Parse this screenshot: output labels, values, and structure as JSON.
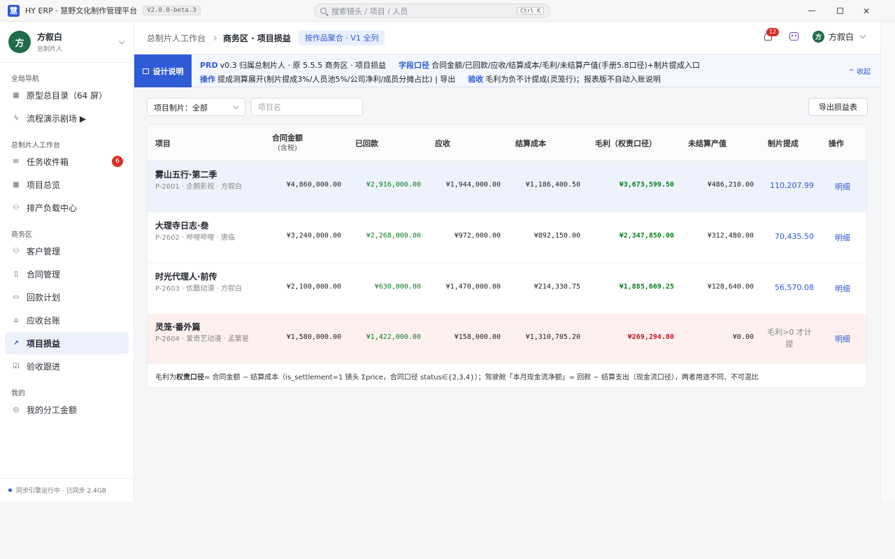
{
  "titlebar": {
    "app_title": "HY ERP · 慧野文化制作管理平台",
    "version": "V2.0.0-beta.3",
    "search_placeholder": "搜索镜头 / 项目 / 人员",
    "shortcut": "Ctrl K"
  },
  "sidebar": {
    "user": {
      "avatar": "方",
      "name": "方叙白",
      "role": "总制片人"
    },
    "groups": [
      {
        "title": "全局导航",
        "items": [
          {
            "label": "原型总目录（64 屏）",
            "icon": "grid-icon"
          },
          {
            "label": "流程演示剧场 ▶",
            "icon": "bolt-icon"
          }
        ]
      },
      {
        "title": "总制片人工作台",
        "items": [
          {
            "label": "任务收件箱",
            "icon": "inbox-icon",
            "badge": "6"
          },
          {
            "label": "项目总览",
            "icon": "grid-icon"
          },
          {
            "label": "排产负载中心",
            "icon": "people-icon"
          }
        ]
      },
      {
        "title": "商务区",
        "items": [
          {
            "label": "客户管理",
            "icon": "people-icon"
          },
          {
            "label": "合同管理",
            "icon": "document-icon"
          },
          {
            "label": "回款计划",
            "icon": "card-icon"
          },
          {
            "label": "应收台账",
            "icon": "bank-icon"
          },
          {
            "label": "项目损益",
            "icon": "chart-icon",
            "active": true
          },
          {
            "label": "验收跟进",
            "icon": "check-box-icon"
          }
        ]
      },
      {
        "title": "我的",
        "items": [
          {
            "label": "我的分工金额",
            "icon": "coin-icon"
          }
        ]
      }
    ],
    "sync_status": "同步引擎运行中 · 已同步 2.4GB"
  },
  "topbar": {
    "crumb_parent": "总制片人工作台",
    "crumb_current": "商务区 · 项目损益",
    "scope_pill": "按作品聚合 · V1 全列",
    "notif_count": "12",
    "user_avatar": "方",
    "user_name": "方叙白"
  },
  "banner": {
    "tag": "设计说明",
    "l1_kw1": "PRD",
    "l1_t1": "v0.3 归属总制片人 · 原 5.5.5 商务区 · 项目损益",
    "l1_kw2": "字段口径",
    "l1_t2": "合同金额/已回款/应收/结算成本/毛利/未结算产值(手册5.8口径)+制片提成入口",
    "l2_kw1": "操作",
    "l2_t1": "提成测算展开(制片提成3%/人员池5%/公司净利/成员分摊占比) | 导出",
    "l2_kw2": "验收",
    "l2_t2": "毛利为负不计提成(灵笼行)；报表版不自动入账说明",
    "collapse": "^ 收起"
  },
  "filters": {
    "project_select": "项目制片：全部",
    "name_placeholder": "项目名",
    "export": "导出损益表"
  },
  "table": {
    "headers": {
      "project": "项目",
      "contract_l1": "合同金额",
      "contract_l2": "(含税)",
      "received": "已回款",
      "receivable": "应收",
      "settled_cost": "结算成本",
      "gross_profit": "毛利（权责口径）",
      "unsettled": "未结算产值",
      "commission": "制片提成",
      "action": "操作"
    },
    "rows": [
      {
        "name": "雾山五行·第二季",
        "sub": "P-2601 · 企鹅影视 · 方叙白",
        "contract": "¥4,860,000.00",
        "received": "¥2,916,000.00",
        "receivable": "¥1,944,000.00",
        "cost": "¥1,186,400.50",
        "profit": "¥3,673,599.50",
        "unsettled": "¥486,210.00",
        "commission": "110,207.99",
        "action": "明细"
      },
      {
        "name": "大理寺日志·叁",
        "sub": "P-2602 · 哔哩哔哩 · 唐临",
        "contract": "¥3,240,000.00",
        "received": "¥2,268,000.00",
        "receivable": "¥972,000.00",
        "cost": "¥892,150.00",
        "profit": "¥2,347,850.00",
        "unsettled": "¥312,480.00",
        "commission": "70,435.50",
        "action": "明细"
      },
      {
        "name": "时光代理人·前传",
        "sub": "P-2603 · 优酷动漫 · 方叙白",
        "contract": "¥2,100,000.00",
        "received": "¥630,000.00",
        "receivable": "¥1,470,000.00",
        "cost": "¥214,330.75",
        "profit": "¥1,885,669.25",
        "unsettled": "¥128,640.00",
        "commission": "56,570.08",
        "action": "明细"
      },
      {
        "name": "灵笼·番外篇",
        "sub": "P-2604 · 爱奇艺动漫 · 孟繁星",
        "contract": "¥1,580,000.00",
        "received": "¥1,422,000.00",
        "receivable": "¥158,000.00",
        "cost": "¥1,310,705.20",
        "profit": "¥269,294.80",
        "unsettled": "¥0.00",
        "commission": "毛利>0 才计提",
        "action": "明细"
      }
    ],
    "footnote_a": "毛利为",
    "footnote_b": "权责口径",
    "footnote_c": " = 合同金额 − 结算成本（is_settlement=1 镜头 Σprice，合同口径 status∈{2,3,4}）；驾驶舱「本月现金流净额」= 回款 − 结算支出（现金流口径），两者用途不同、不可混比"
  }
}
